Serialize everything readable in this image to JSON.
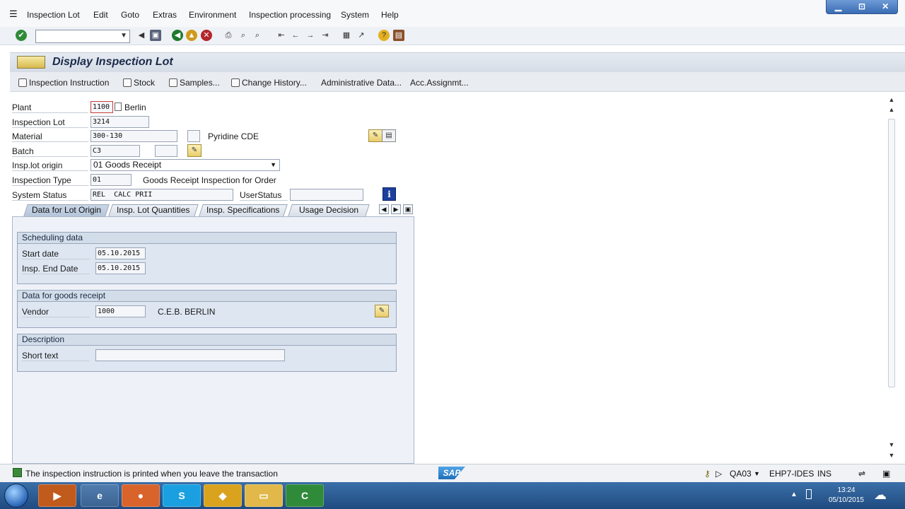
{
  "menu": {
    "items": [
      "Inspection Lot",
      "Edit",
      "Goto",
      "Extras",
      "Environment",
      "Inspection processing",
      "System",
      "Help"
    ]
  },
  "window_controls": {
    "minimize": "▁",
    "maximize": "⊡",
    "close": "✕"
  },
  "title": "Display Inspection Lot",
  "app_toolbar": {
    "inspection_instruction": "Inspection Instruction",
    "stock": "Stock",
    "samples": "Samples...",
    "change_history": "Change History...",
    "administrative_data": "Administrative Data...",
    "acc_assignment": "Acc.Assignmt..."
  },
  "header": {
    "plant_label": "Plant",
    "plant_value": "1100",
    "plant_name": "Berlin",
    "inspection_lot_label": "Inspection Lot",
    "inspection_lot_value": "3214",
    "material_label": "Material",
    "material_value": "300-130",
    "material_desc": "Pyridine CDE",
    "batch_label": "Batch",
    "batch_value": "C3",
    "insp_lot_origin_label": "Insp.lot origin",
    "insp_lot_origin_value": "01 Goods Receipt",
    "inspection_type_label": "Inspection Type",
    "inspection_type_value": "01",
    "inspection_type_desc": "Goods Receipt Inspection for Order",
    "system_status_label": "System Status",
    "system_status_value": "REL  CALC PRII",
    "user_status_label": "UserStatus",
    "user_status_value": ""
  },
  "tabs": [
    {
      "label": "Data for Lot Origin",
      "active": true
    },
    {
      "label": "Insp. Lot Quantities",
      "active": false
    },
    {
      "label": "Insp. Specifications",
      "active": false
    },
    {
      "label": "Usage Decision",
      "active": false
    }
  ],
  "scheduling": {
    "header": "Scheduling data",
    "start_date_label": "Start date",
    "start_date_value": "05.10.2015",
    "end_date_label": "Insp. End Date",
    "end_date_value": "05.10.2015"
  },
  "goods_receipt": {
    "header": "Data for goods receipt",
    "vendor_label": "Vendor",
    "vendor_value": "1000",
    "vendor_name": "C.E.B. BERLIN"
  },
  "description": {
    "header": "Description",
    "short_text_label": "Short text",
    "short_text_value": ""
  },
  "status_bar": {
    "message": "The inspection instruction is printed when you leave the transaction",
    "sap_logo": "SAP",
    "transaction": "QA03",
    "system": "EHP7-IDES",
    "mode": "INS"
  },
  "taskbar": {
    "time": "13:24",
    "date": "05/10/2015"
  },
  "colors": {
    "accent": "#3a6cb4",
    "panel": "#eef2f8",
    "group": "#dde6f1",
    "status_ok": "#3a8a3a"
  }
}
